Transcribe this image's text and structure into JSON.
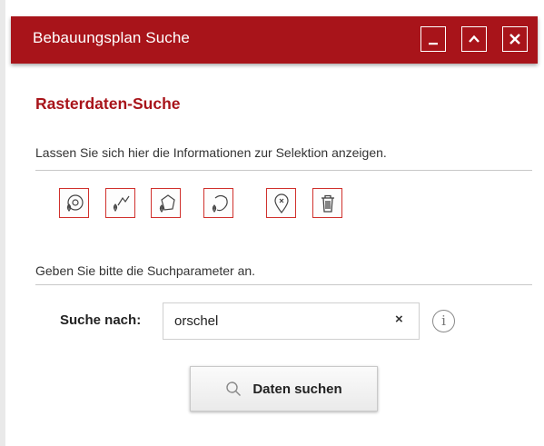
{
  "window": {
    "title": "Bebauungsplan Suche",
    "buttons": [
      {
        "name": "minimize-button",
        "icon": "minimize-icon"
      },
      {
        "name": "collapse-button",
        "icon": "chevron-up-icon"
      },
      {
        "name": "close-button",
        "icon": "close-icon"
      }
    ],
    "accent_color": "#a8141a"
  },
  "section": {
    "title": "Rasterdaten-Suche",
    "selection_hint": "Lassen Sie sich hier die Informationen zur Selektion anzeigen.",
    "params_hint": "Geben Sie bitte die Suchparameter an."
  },
  "tools": [
    {
      "name": "select-point-icon"
    },
    {
      "name": "select-line-icon"
    },
    {
      "name": "select-polygon-icon"
    },
    {
      "name": "select-freehand-icon"
    },
    {
      "name": "clear-marker-icon"
    },
    {
      "name": "delete-trash-icon"
    }
  ],
  "search": {
    "label": "Suche nach:",
    "value": "orschel",
    "clear_symbol": "×",
    "info_symbol": "i",
    "button_label": "Daten suchen"
  }
}
